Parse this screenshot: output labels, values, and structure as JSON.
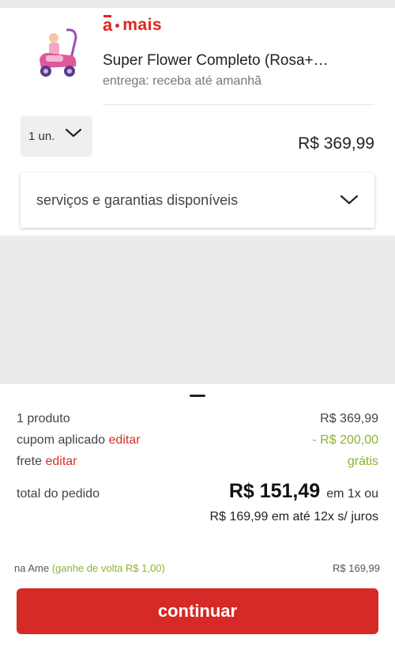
{
  "brand": {
    "logo_letter": "a",
    "logo_word": "mais"
  },
  "product": {
    "name": "Super Flower Completo (Rosa+…",
    "delivery": "entrega: receba até amanhã",
    "quantity": "1 un.",
    "price": "R$ 369,99",
    "services_label": "serviços e garantias disponíveis"
  },
  "summary": {
    "products_label": "1 produto",
    "products_value": "R$ 369,99",
    "coupon_label": "cupom aplicado",
    "coupon_edit": "editar",
    "coupon_value": "- R$ 200,00",
    "shipping_label": "frete",
    "shipping_edit": "editar",
    "shipping_value": "grátis",
    "total_label": "total do pedido",
    "total_value": "R$ 151,49",
    "total_suffix": "em 1x ou",
    "installments": "R$ 169,99 em até 12x s/ juros",
    "ame_label": "na Ame",
    "ame_cashback": "(ganhe de volta R$ 1,00)",
    "ame_value": "R$ 169,99"
  },
  "cta": {
    "continue_label": "continuar"
  },
  "colors": {
    "brand_red": "#e1251b",
    "button_red": "#d52a26",
    "discount_green": "#8bb431"
  }
}
